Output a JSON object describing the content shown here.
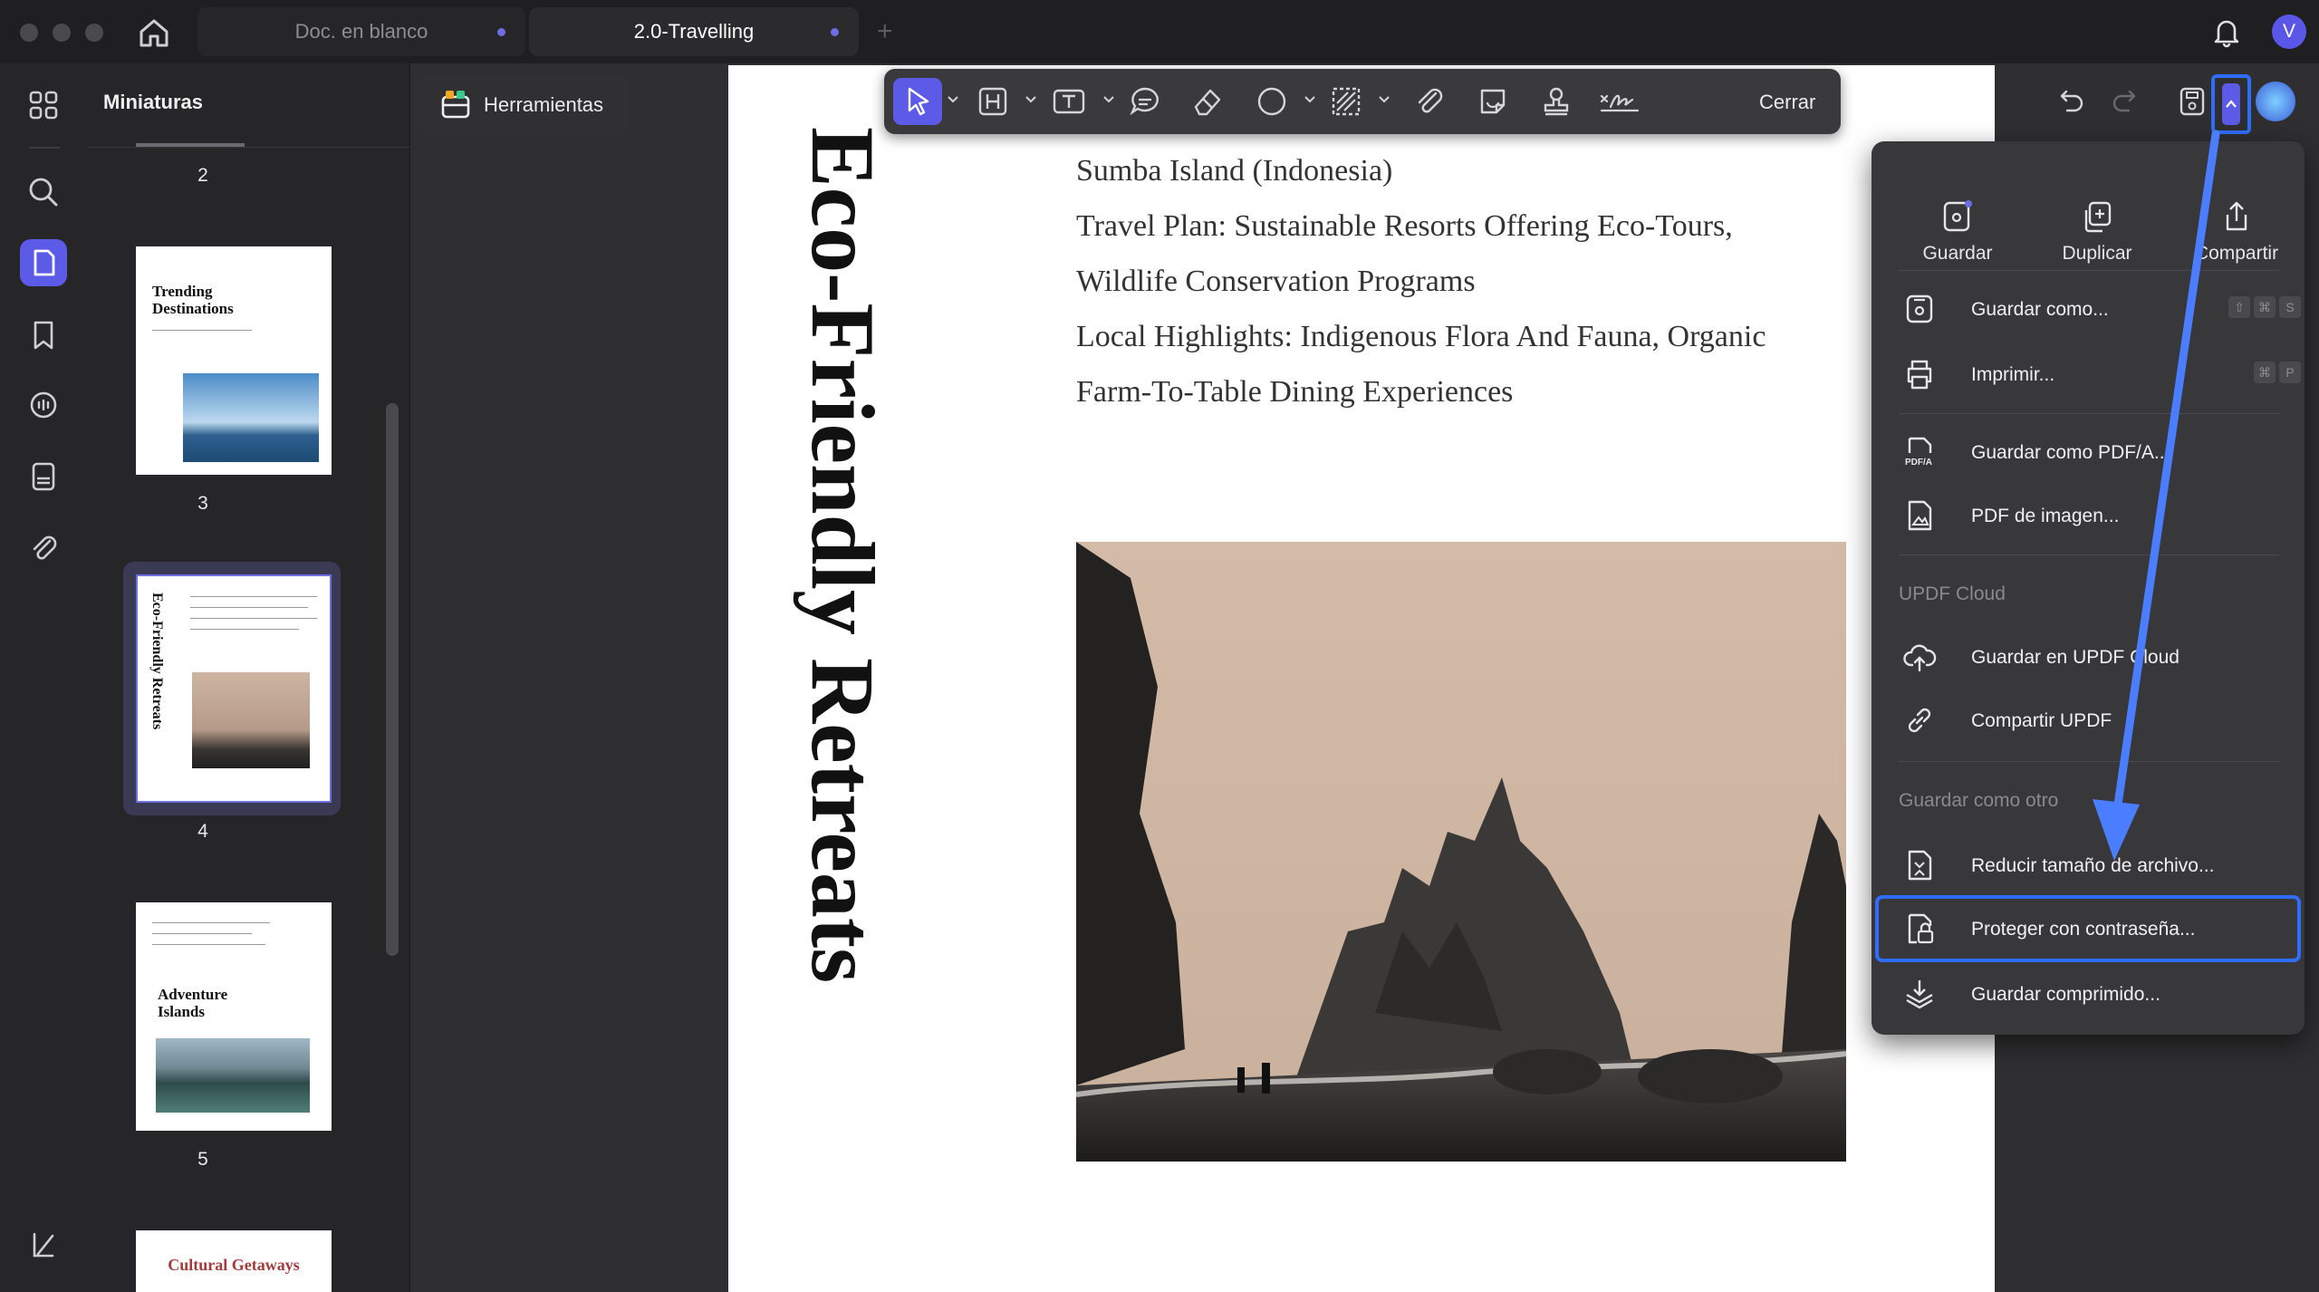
{
  "tabs": [
    {
      "label": "Doc. en blanco"
    },
    {
      "label": "2.0-Travelling"
    }
  ],
  "user": {
    "avatar_letter": "V"
  },
  "sidebar": {
    "title": "Miniaturas"
  },
  "thumbnails": [
    {
      "page": "2"
    },
    {
      "page": "3",
      "title": "Trending Destinations"
    },
    {
      "page": "4",
      "title": "Eco-Friendly Retreats"
    },
    {
      "page": "5",
      "title": "Adventure Islands"
    },
    {
      "title": "Cultural Getaways"
    }
  ],
  "tools_button": {
    "label": "Herramientas"
  },
  "toolbar": {
    "close_label": "Cerrar"
  },
  "document": {
    "vertical_title": "Eco-Friendly Retreats",
    "lines": [
      "Sumba Island (Indonesia)",
      "Travel Plan: Sustainable Resorts Offering Eco-Tours,",
      "Wildlife Conservation Programs",
      "Local Highlights: Indigenous Flora And Fauna, Organic",
      "Farm-To-Table Dining Experiences"
    ]
  },
  "menu": {
    "top_actions": [
      {
        "label": "Guardar",
        "icon": "save-icon"
      },
      {
        "label": "Duplicar",
        "icon": "duplicate-icon"
      },
      {
        "label": "Compartir",
        "icon": "share-icon"
      }
    ],
    "items": [
      {
        "label": "Guardar como...",
        "icon": "save-as-icon",
        "shortcut": [
          "⇧",
          "⌘",
          "S"
        ]
      },
      {
        "label": "Imprimir...",
        "icon": "printer-icon",
        "shortcut": [
          "⌘",
          "P"
        ]
      },
      {
        "label": "Guardar como PDF/A...",
        "icon": "pdfa-icon"
      },
      {
        "label": "PDF de imagen...",
        "icon": "image-pdf-icon"
      }
    ],
    "cloud_header": "UPDF Cloud",
    "cloud_items": [
      {
        "label": "Guardar en UPDF Cloud",
        "icon": "cloud-upload-icon"
      },
      {
        "label": "Compartir UPDF",
        "icon": "link-icon"
      }
    ],
    "other_header": "Guardar como otro",
    "other_items": [
      {
        "label": "Reducir tamaño de archivo...",
        "icon": "compress-icon"
      },
      {
        "label": "Proteger con contraseña...",
        "icon": "lock-icon"
      },
      {
        "label": "Guardar comprimido...",
        "icon": "zip-icon"
      }
    ]
  },
  "colors": {
    "accent": "#5b5be8",
    "highlight": "#2f6dff",
    "arrow": "#4a7dff"
  }
}
